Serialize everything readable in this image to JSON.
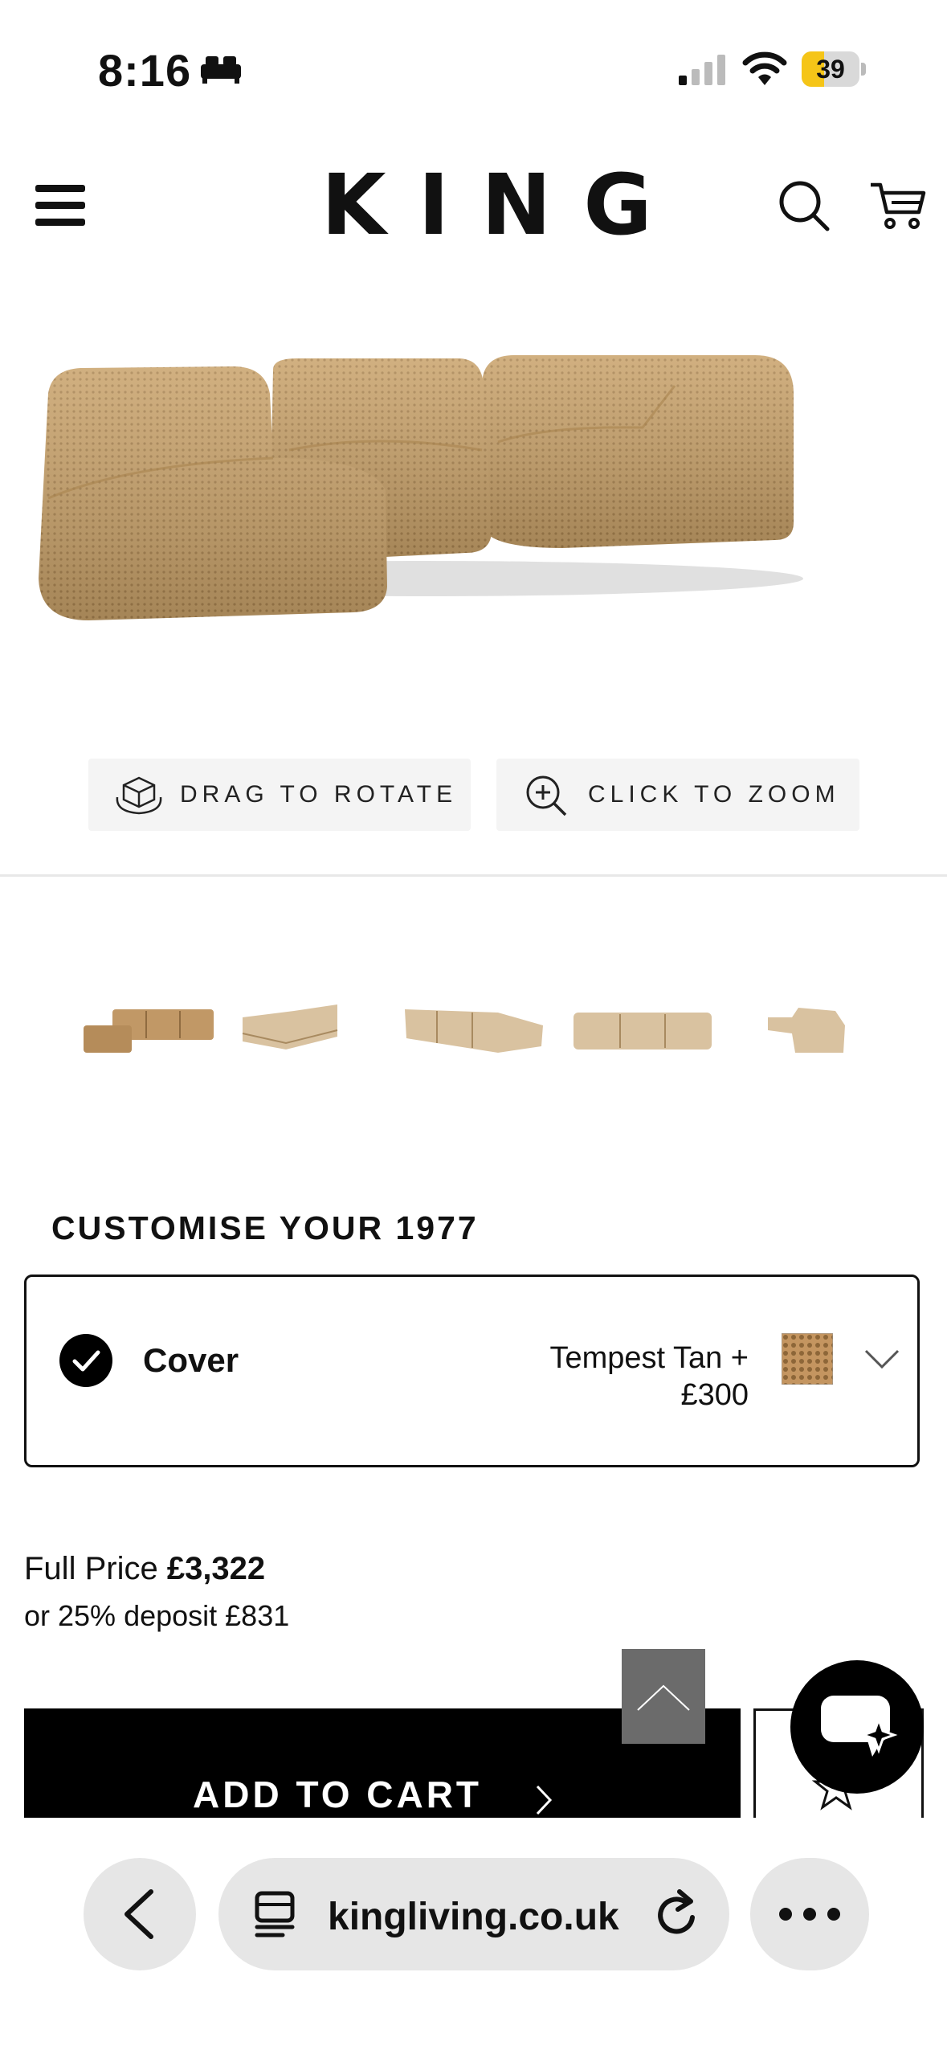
{
  "status_bar": {
    "time": "8:16",
    "battery_level": "39",
    "battery_fraction": 0.39,
    "icons": [
      "bed-icon",
      "signal-icon",
      "wifi-icon",
      "battery-icon"
    ]
  },
  "header": {
    "logo": "KING",
    "icons": [
      "menu-icon",
      "search-icon",
      "cart-icon"
    ]
  },
  "viewer": {
    "rotate_label": "DRAG TO ROTATE",
    "zoom_label": "CLICK TO ZOOM"
  },
  "thumbnails": [
    "thumbnail-front",
    "thumbnail-angle",
    "thumbnail-back",
    "thumbnail-side-long",
    "thumbnail-side"
  ],
  "customise": {
    "title": "CUSTOMISE YOUR 1977",
    "cover_label": "Cover",
    "cover_value_line1": "Tempest Tan +",
    "cover_value_line2": "£300"
  },
  "pricing": {
    "full_price_label": "Full Price",
    "full_price_value": "£3,322",
    "deposit_text": "or 25% deposit £831"
  },
  "actions": {
    "add_to_cart": "ADD TO CART"
  },
  "browser": {
    "url": "kingliving.co.uk"
  },
  "colors": {
    "product_tan": "#c9a26a",
    "battery_yellow": "#f5c518",
    "button_black": "#000000"
  }
}
